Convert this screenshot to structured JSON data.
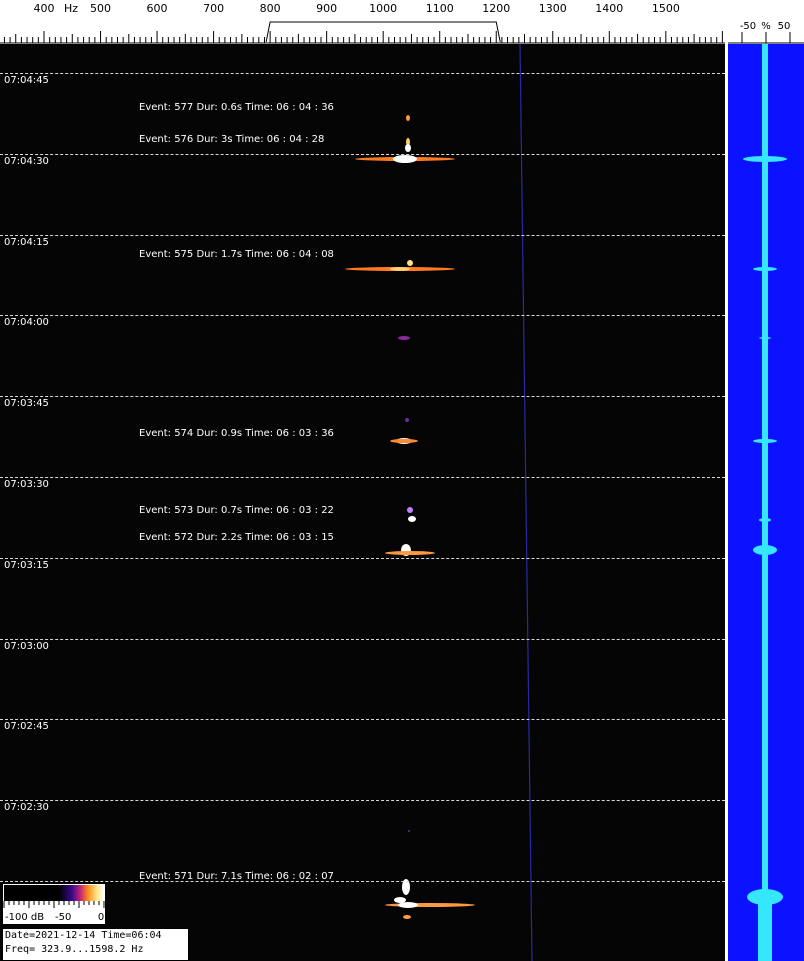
{
  "frequency_scale": {
    "unit": "Hz",
    "labels": [
      "400",
      "500",
      "600",
      "700",
      "800",
      "900",
      "1000",
      "1100",
      "1200",
      "1300",
      "1400",
      "1500"
    ],
    "selected_band": [
      "800",
      "1200"
    ]
  },
  "time_labels": [
    "07:04:45",
    "07:04:30",
    "07:04:15",
    "07:04:00",
    "07:03:45",
    "07:03:30",
    "07:03:15",
    "07:03:00",
    "07:02:45",
    "07:02:30"
  ],
  "events": [
    {
      "text": "Event:  577  Dur:  0.6s  Time:  06 : 04 : 36"
    },
    {
      "text": "Event:  576  Dur:  3s  Time:  06 : 04 : 28"
    },
    {
      "text": "Event:  575  Dur:  1.7s  Time:  06 : 04 : 08"
    },
    {
      "text": "Event:  574  Dur:  0.9s  Time:  06 : 03 : 36"
    },
    {
      "text": "Event:  573  Dur:  0.7s  Time:  06 : 03 : 22"
    },
    {
      "text": "Event:  572  Dur:  2.2s  Time:  06 : 03 : 15"
    },
    {
      "text": "Event:  571  Dur:  7.1s  Time:  06 : 02 : 07"
    }
  ],
  "side_panel": {
    "scale_labels": [
      "-50",
      "%",
      "50"
    ],
    "background": "#0a12ff",
    "trace_color": "#35e6ff"
  },
  "legend": {
    "min_label": "-100 dB",
    "mid_label": "-50",
    "max_label": "0"
  },
  "info": {
    "date_line": "Date=2021-12-14 Time=06:04",
    "freq_line": "Freq= 323.9...1598.2 Hz"
  }
}
